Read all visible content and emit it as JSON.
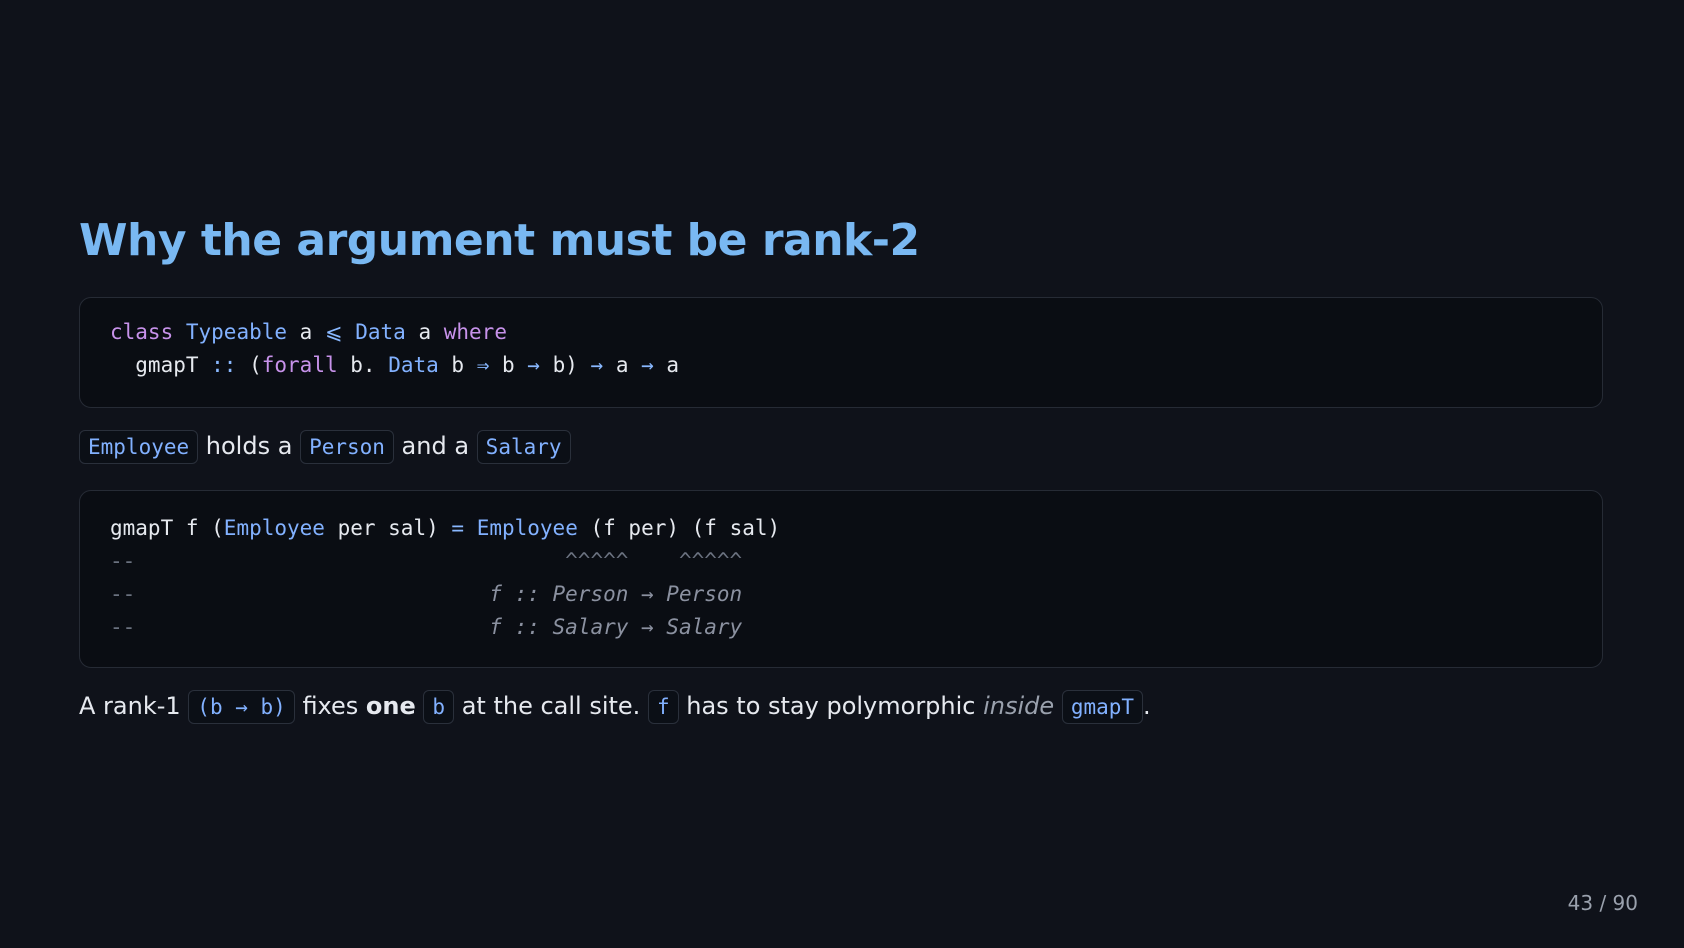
{
  "slide": {
    "title": "Why the argument must be rank-2",
    "code1": {
      "l1": {
        "kw1": "class",
        "ty1": "Typeable",
        "a1": " a ",
        "op1": "⩽",
        "ty2": "Data",
        "a2": " a ",
        "kw2": "where"
      },
      "l2": {
        "p1": "  gmapT ",
        "op1": "::",
        "p2": " (",
        "kw1": "forall",
        "p3": " b. ",
        "ty1": "Data",
        "p4": " b ",
        "op2": "⇒",
        "p5": " b ",
        "op3": "→",
        "p6": " b) ",
        "op4": "→",
        "p7": " a ",
        "op5": "→",
        "p8": " a"
      }
    },
    "para1": {
      "code1": "Employee",
      "t1": " holds a ",
      "code2": "Person",
      "t2": " and a ",
      "code3": "Salary"
    },
    "code2": {
      "l1": {
        "p1": "gmapT f (",
        "ty1": "Employee",
        "p2": " per sal) ",
        "op1": "=",
        "ty2": "Employee",
        "p3": " (f per) (f sal)"
      },
      "l2": {
        "c1": "--",
        "c2": "                                  ^^^^^    ^^^^^"
      },
      "l3": {
        "c1": "--",
        "c2": "                            f :: Person → Person"
      },
      "l4": {
        "c1": "--",
        "c2": "                            f :: Salary → Salary"
      }
    },
    "para2": {
      "t1": "A rank-1 ",
      "code1": "(b → b)",
      "t2": " fixes ",
      "b1": "one",
      "code2": "b",
      "t3": " at the call site. ",
      "code3": "f",
      "t4": " has to stay polymorphic ",
      "i1": "inside",
      "code4": "gmapT",
      "t5": "."
    },
    "page": "43 / 90"
  }
}
